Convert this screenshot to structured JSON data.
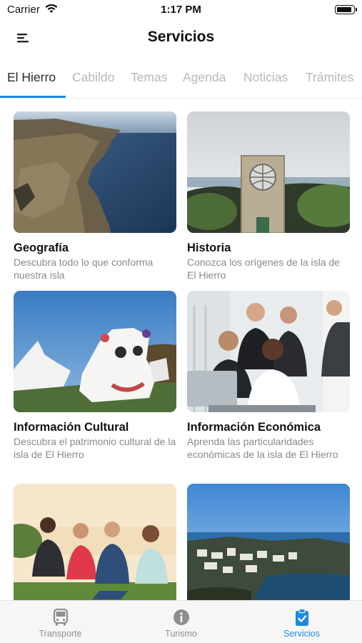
{
  "status_bar": {
    "carrier": "Carrier",
    "time": "1:17 PM"
  },
  "nav": {
    "title": "Servicios",
    "menu_icon": "menu-icon"
  },
  "tabs": [
    {
      "label": "El Hierro",
      "active": true
    },
    {
      "label": "Cabildo",
      "active": false
    },
    {
      "label": "Temas",
      "active": false
    },
    {
      "label": "Agenda",
      "active": false
    },
    {
      "label": "Noticias",
      "active": false
    },
    {
      "label": "Trámites",
      "active": false
    }
  ],
  "cards": [
    {
      "title": "Geografía",
      "description": "Descubra todo lo que conforma nuestra isla",
      "image": "coastline-photo"
    },
    {
      "title": "Historia",
      "description": "Conozca los orígenes de la isla de El Hierro",
      "image": "monument-photo"
    },
    {
      "title": "Información Cultural",
      "description": "Descubra el patrimonio cultural de la isla de El Hierro",
      "image": "carnival-sculpture-photo"
    },
    {
      "title": "Información Económica",
      "description": "Aprenda las particularidades económicas de la isla de El Hierro",
      "image": "office-team-photo"
    },
    {
      "title": "",
      "description": "",
      "image": "friends-on-grass-photo"
    },
    {
      "title": "",
      "description": "",
      "image": "coastal-town-photo"
    }
  ],
  "tabbar": [
    {
      "label": "Transporte",
      "icon": "bus-icon",
      "active": false
    },
    {
      "label": "Turismo",
      "icon": "info-icon",
      "active": false
    },
    {
      "label": "Servicios",
      "icon": "clipboard-check-icon",
      "active": true
    }
  ],
  "colors": {
    "accent": "#1e88e5",
    "inactive_tab": "#b8b8b8",
    "muted_text": "#8a8a8a"
  }
}
